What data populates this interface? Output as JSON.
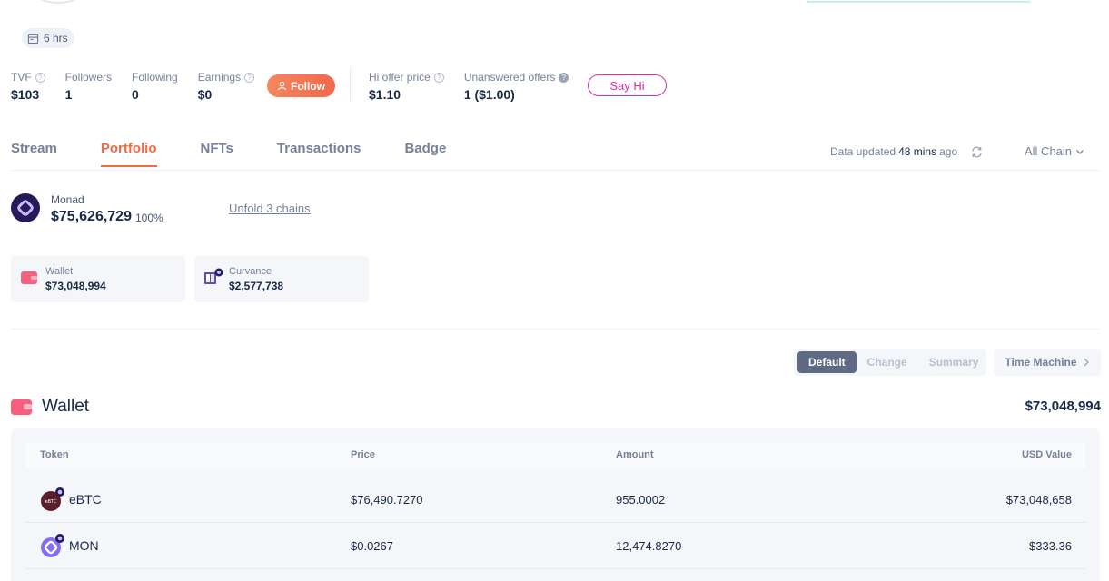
{
  "header": {
    "duration_badge": "6 hrs"
  },
  "stats": [
    {
      "label": "TVF",
      "value": "$103",
      "help": "?"
    },
    {
      "label": "Followers",
      "value": "1"
    },
    {
      "label": "Following",
      "value": "0"
    },
    {
      "label": "Earnings",
      "value": "$0",
      "help": "?"
    }
  ],
  "follow_button": "Follow",
  "offer_stats": [
    {
      "label": "Hi offer price",
      "value": "$1.10",
      "help": "?"
    },
    {
      "label": "Unanswered offers",
      "value": "1 ($1.00)",
      "help": "?"
    }
  ],
  "say_hi_button": "Say Hi",
  "tabs": [
    {
      "label": "Stream"
    },
    {
      "label": "Portfolio",
      "active": true
    },
    {
      "label": "NFTs"
    },
    {
      "label": "Transactions"
    },
    {
      "label": "Badge"
    }
  ],
  "data_updated": {
    "prefix": "Data updated",
    "time": "48 mins",
    "suffix": "ago"
  },
  "chain_select": "All Chain",
  "chain": {
    "name": "Monad",
    "value": "$75,626,729",
    "percent": "100%",
    "unfold_link": "Unfold 3 chains"
  },
  "protocols": [
    {
      "name": "Wallet",
      "value": "$73,048,994"
    },
    {
      "name": "Curvance",
      "value": "$2,577,738"
    }
  ],
  "view_modes": [
    "Default",
    "Change",
    "Summary"
  ],
  "active_view": "Default",
  "time_machine": "Time Machine",
  "wallet": {
    "title": "Wallet",
    "total": "$73,048,994",
    "columns": [
      "Token",
      "Price",
      "Amount",
      "USD Value"
    ],
    "rows": [
      {
        "token": "eBTC",
        "icon_label": "eBTC",
        "price": "$76,490.7270",
        "amount": "955.0002",
        "usd_value": "$73,048,658"
      },
      {
        "token": "MON",
        "price": "$0.0267",
        "amount": "12,474.8270",
        "usd_value": "$333.36"
      }
    ]
  },
  "colors": {
    "accent": "#f06b48",
    "say_hi": "#e02ea7",
    "monad": "#261a59",
    "wallet_icon": "#f4607e"
  }
}
